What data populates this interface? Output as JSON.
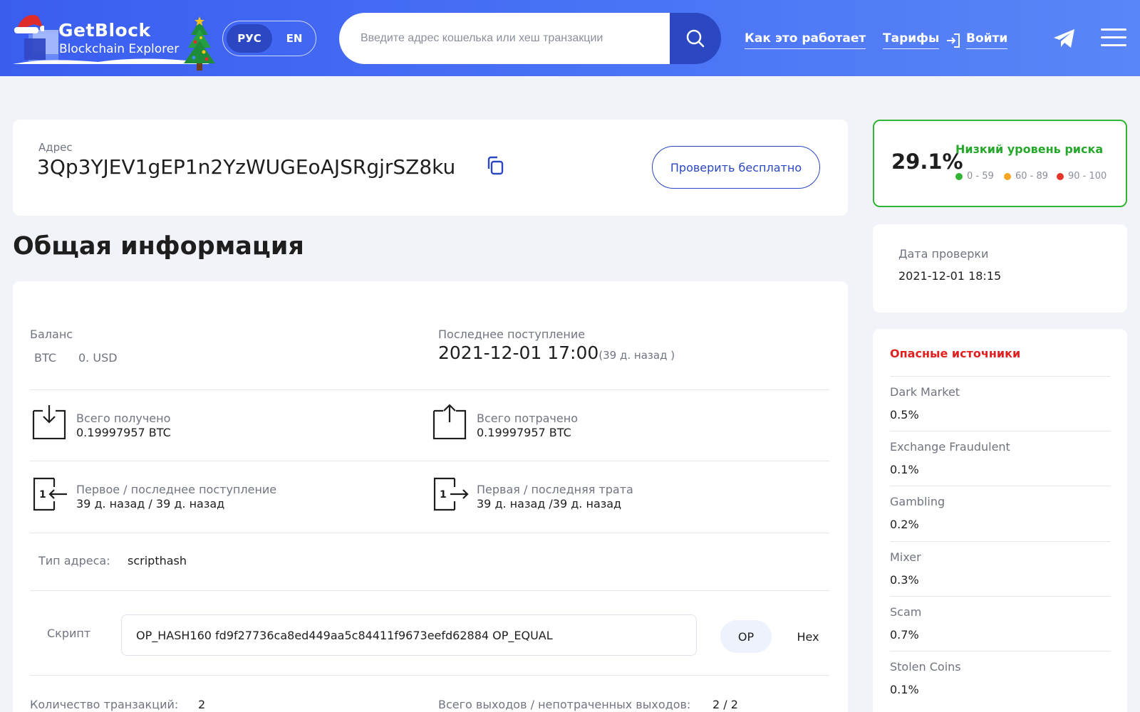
{
  "header": {
    "logo_title": "GetBlock",
    "logo_subtitle": "Blockchain Explorer",
    "lang_ru": "РУС",
    "lang_en": "EN",
    "search_placeholder": "Введите адрес кошелька или хеш транзакции",
    "nav_how": "Как это работает",
    "nav_tariffs": "Тарифы",
    "nav_login": "Войти"
  },
  "address": {
    "label": "Адрес",
    "value": "3Qp3YJEV1gEP1n2YzWUGEoAJSRgjrSZ8ku",
    "check_button": "Проверить бесплатно"
  },
  "page_title": "Общая информация",
  "info": {
    "balance_label": "Баланс",
    "balance_btc_label": "BTC",
    "balance_value": "0. USD",
    "last_incoming_label": "Последнее поступление",
    "last_incoming_date": "2021-12-01 17:00",
    "last_incoming_ago": "(39 д. назад )",
    "total_received_label": "Всего получено",
    "total_received_value": "0.19997957 BTC",
    "total_spent_label": "Всего потрачено",
    "total_spent_value": "0.19997957 BTC",
    "first_last_in_label": "Первое / последнее поступление",
    "first_last_in_value": "39 д. назад / 39 д. назад",
    "first_last_out_label": "Первая / последняя трата",
    "first_last_out_value": "39 д. назад /39 д. назад",
    "address_type_label": "Тип адреса:",
    "address_type_value": "scripthash",
    "script_label": "Скрипт",
    "script_value": "OP_HASH160 fd9f27736ca8ed449aa5c84411f9673eefd62884 OP_EQUAL",
    "op_button": "OP",
    "hex_button": "Hex",
    "tx_count_label": "Количество транзакций:",
    "tx_count_value": "2",
    "outputs_label": "Всего выходов / непотраченных выходов:",
    "outputs_value": "2 / 2"
  },
  "risk": {
    "percent": "29.1%",
    "level": "Низкий уровень риска",
    "legend_low": "0 - 59",
    "legend_mid": "60 - 89",
    "legend_high": "90 - 100",
    "colors": {
      "low": "#2fb533",
      "mid": "#f5a623",
      "high": "#e8332b"
    }
  },
  "check_date": {
    "label": "Дата проверки",
    "value": "2021-12-01 18:15"
  },
  "sources": {
    "title": "Опасные источники",
    "items": [
      {
        "name": "Dark Market",
        "value": "0.5%"
      },
      {
        "name": "Exchange Fraudulent",
        "value": "0.1%"
      },
      {
        "name": "Gambling",
        "value": "0.2%"
      },
      {
        "name": "Mixer",
        "value": "0.3%"
      },
      {
        "name": "Scam",
        "value": "0.7%"
      },
      {
        "name": "Stolen Coins",
        "value": "0.1%"
      }
    ]
  }
}
